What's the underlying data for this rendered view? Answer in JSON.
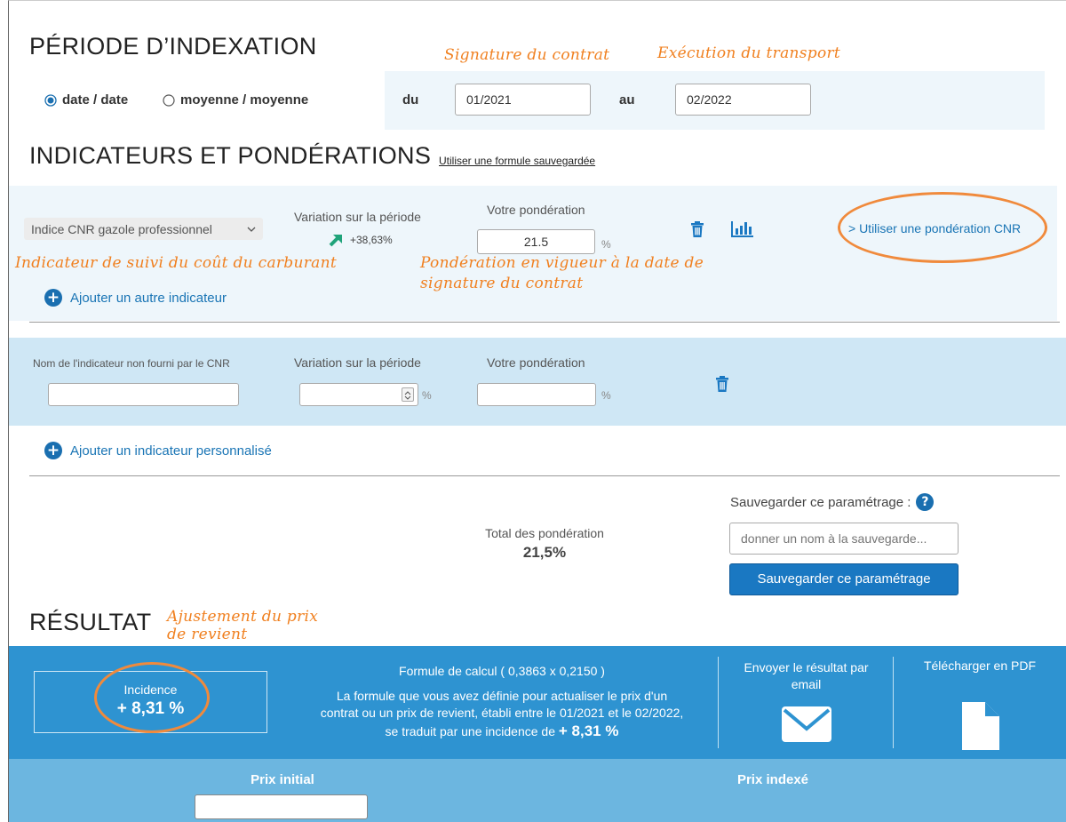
{
  "periode": {
    "title": "PÉRIODE D’INDEXATION",
    "radio_date": "date / date",
    "radio_moyenne": "moyenne / moyenne",
    "du_label": "du",
    "du_value": "01/2021",
    "au_label": "au",
    "au_value": "02/2022"
  },
  "annotations": {
    "signature": "Signature du contrat",
    "execution": "Exécution du transport",
    "indicateur_suivi": "Indicateur de suivi du coût du carburant",
    "ponderation_vigueur_1": "Pondération en vigueur à la date de",
    "ponderation_vigueur_2": "signature du contrat",
    "ajustement_1": "Ajustement du prix",
    "ajustement_2": "de revient"
  },
  "indicateurs": {
    "title": "INDICATEURS ET PONDÉRATIONS",
    "use_saved_formula": "Utiliser une formule sauvegardée",
    "select_value": "Indice CNR gazole professionnel",
    "variation_label": "Variation sur la période",
    "variation_value": "+38,63%",
    "ponderation_label": "Votre pondération",
    "ponderation_value": "21.5",
    "percent": "%",
    "use_cnr": "> Utiliser une pondération CNR",
    "add_other": "Ajouter un autre indicateur"
  },
  "custom": {
    "name_label": "Nom de l'indicateur non fourni par le CNR",
    "variation_label": "Variation sur la période",
    "ponderation_label": "Votre pondération",
    "percent": "%",
    "add_custom": "Ajouter un indicateur personnalisé"
  },
  "totals": {
    "label": "Total des pondération",
    "value": "21,5%"
  },
  "save": {
    "label": "Sauvegarder ce paramétrage :",
    "placeholder": "donner un nom à la sauvegarde...",
    "button": "Sauvegarder ce paramétrage"
  },
  "resultat": {
    "title": "RÉSULTAT",
    "incidence_label": "Incidence",
    "incidence_value": "+ 8,31 %",
    "formula_title": "Formule de calcul ( 0,3863 x 0,2150 )",
    "desc_1": "La formule que vous avez définie pour actualiser le prix d'un",
    "desc_2": "contrat ou un prix de revient, établi entre le 01/2021 et le 02/2022,",
    "desc_3": "se traduit par une incidence de",
    "desc_value": "+ 8,31 %",
    "email_1": "Envoyer le résultat par",
    "email_2": "email",
    "pdf": "Télécharger en PDF"
  },
  "prix": {
    "initial": "Prix initial",
    "indexe": "Prix indexé"
  },
  "colors": {
    "accent": "#1a78c2",
    "result_bg": "#2e93d1",
    "prices_bg": "#6cb6e0",
    "annotation": "#f08020",
    "positive": "#1fa37a"
  }
}
